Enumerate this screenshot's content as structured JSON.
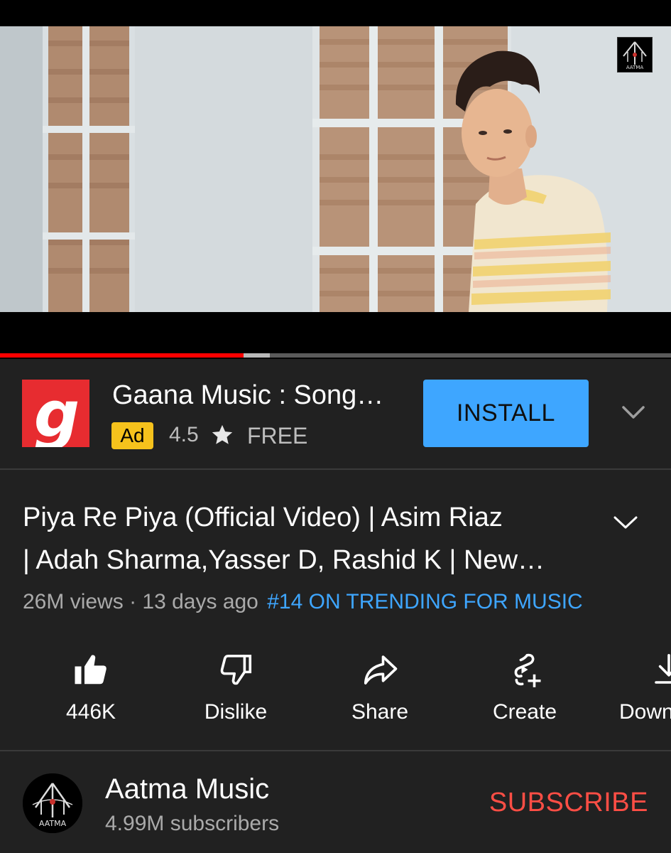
{
  "player": {
    "progress_played_fraction": 0.363,
    "progress_buffered_fraction": 0.402,
    "watermark_text": "AATMA",
    "colors": {
      "played": "#ff0000",
      "buffered": "#b8b8b8",
      "track": "#5a5a5a"
    }
  },
  "ad": {
    "logo_glyph": "g",
    "logo_color": "#e72c30",
    "title": "Gaana Music : Song…",
    "badge": "Ad",
    "rating": "4.5",
    "rating_icon": "star-icon",
    "price": "FREE",
    "install_label": "INSTALL",
    "install_color": "#3ea6ff",
    "expand_icon": "chevron-down-icon"
  },
  "video": {
    "title_line1": "Piya Re Piya (Official Video) | Asim Riaz",
    "title_line2": "| Adah Sharma,Yasser D, Rashid K | New…",
    "views": "26M views",
    "separator": "·",
    "age": "13 days ago",
    "trending": "#14 ON TRENDING FOR MUSIC",
    "trending_color": "#3ea6ff"
  },
  "actions": [
    {
      "icon": "like-icon",
      "label": "446K"
    },
    {
      "icon": "dislike-icon",
      "label": "Dislike"
    },
    {
      "icon": "share-icon",
      "label": "Share"
    },
    {
      "icon": "create-icon",
      "label": "Create"
    },
    {
      "icon": "download-icon",
      "label": "Down"
    }
  ],
  "channel": {
    "name": "Aatma Music",
    "subscribers": "4.99M subscribers",
    "avatar_text": "AATMA",
    "subscribe_label": "SUBSCRIBE",
    "subscribe_color": "#ff4e45"
  }
}
